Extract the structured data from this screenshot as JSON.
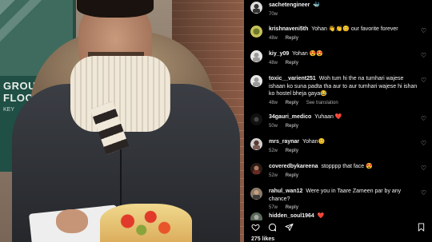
{
  "sign": {
    "line1": "GROUN",
    "line2": "FLOO",
    "line3": "KEY"
  },
  "comments": [
    {
      "user": "sachetengineer",
      "text": "🐳",
      "time": "70w",
      "replies": "",
      "translate": ""
    },
    {
      "user": "krishnaveni5th",
      "text": "Yohan 👋👏😊 our favorite forever",
      "time": "48w",
      "replies": "Reply",
      "translate": ""
    },
    {
      "user": "kiy_y09",
      "text": "Yohan 😍😍",
      "time": "48w",
      "replies": "Reply",
      "translate": ""
    },
    {
      "user": "toxic__varient251",
      "text": "Woh tum hi the na tumhari wajese ishaan ko suna padta tha aur to aur tumhari wajese hi ishan ko hostel bheja gaya😂",
      "time": "48w",
      "replies": "Reply",
      "translate": "See translation"
    },
    {
      "user": "34gauri_medico",
      "text": "Yuhaan ❤️",
      "time": "50w",
      "replies": "Reply",
      "translate": ""
    },
    {
      "user": "mrs_raynar",
      "text": "Yohan😊",
      "time": "52w",
      "replies": "Reply",
      "translate": ""
    },
    {
      "user": "coveredbykareena",
      "text": "stopppp that face 😍",
      "time": "52w",
      "replies": "Reply",
      "translate": ""
    },
    {
      "user": "rahul_wan12",
      "text": "Were you in Taare Zameen par by any chance?",
      "time": "57w",
      "replies": "Reply",
      "translate": ""
    },
    {
      "user": "hidden_soul1964",
      "text": "❤️",
      "time": "",
      "replies": "",
      "translate": ""
    }
  ],
  "likes": "275 likes",
  "icons": {
    "like": "heart-outline-icon",
    "comment": "comment-bubble-icon",
    "share": "send-icon",
    "save": "bookmark-icon",
    "comment_like": "heart-outline-icon"
  },
  "colors": {
    "background": "#000000",
    "text": "#f5f5f5",
    "meta": "#a8a8a8"
  }
}
